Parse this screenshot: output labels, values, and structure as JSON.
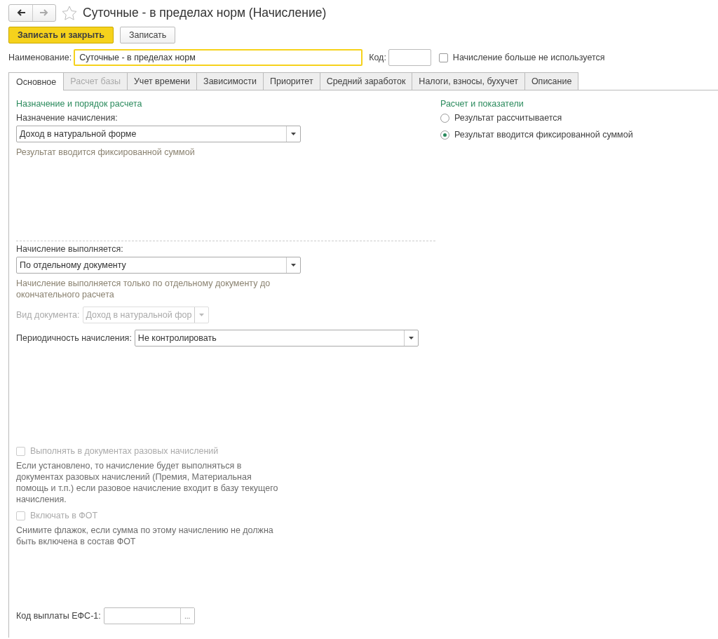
{
  "nav": [
    {
      "kind": "back",
      "disabled": false
    },
    {
      "kind": "forward",
      "disabled": true
    }
  ],
  "favorite": false,
  "title": "Суточные - в пределах норм (Начисление)",
  "buttons": [
    {
      "label": "Записать и закрыть",
      "kind": "primary"
    },
    {
      "label": "Записать",
      "kind": "secondary"
    }
  ],
  "name_field": {
    "label": "Наименование:",
    "value": "Суточные - в пределах норм",
    "focused": true
  },
  "code_field": {
    "label": "Код:"
  },
  "not_used": {
    "label": "Начисление больше не используется",
    "checked": false
  },
  "tabs": [
    {
      "label": "Основное",
      "selected": true,
      "disabled": false
    },
    {
      "label": "Расчет базы",
      "selected": false,
      "disabled": true
    },
    {
      "label": "Учет времени",
      "selected": false,
      "disabled": false
    },
    {
      "label": "Зависимости",
      "selected": false,
      "disabled": false
    },
    {
      "label": "Приоритет",
      "selected": false,
      "disabled": false
    },
    {
      "label": "Средний заработок",
      "selected": false,
      "disabled": false
    },
    {
      "label": "Налоги, взносы, бухучет",
      "selected": false,
      "disabled": false
    },
    {
      "label": "Описание",
      "selected": false,
      "disabled": false
    }
  ],
  "left": {
    "section_title": "Назначение и порядок расчета",
    "purpose": {
      "label": "Назначение начисления:",
      "value": "Доход в натуральной форме"
    },
    "purpose_note": "Результат вводится фиксированной суммой",
    "execution": {
      "label": "Начисление выполняется:",
      "value": "По отдельному документу"
    },
    "execution_note": "Начисление выполняется только по отдельному документу до окончательного расчета",
    "doc_type": {
      "label": "Вид документа:",
      "value": "Доход в натуральной фор",
      "disabled": true
    },
    "periodicity": {
      "label": "Периодичность начисления:",
      "value": "Не контролировать"
    },
    "one_time": {
      "label": "Выполнять в документах разовых начислений",
      "checked": false,
      "disabled": true
    },
    "one_time_note": "Если установлено, то начисление будет выполняться в документах разовых начислений (Премия, Материальная помощь и т.п.) если разовое начисление входит в базу текущего начисления.",
    "fot": {
      "label": "Включать в ФОТ",
      "checked": false,
      "disabled": true
    },
    "fot_note": "Снимите флажок, если сумма по этому начислению не должна быть включена в состав ФОТ",
    "efs": {
      "label": "Код выплаты ЕФС-1:",
      "button": "..."
    }
  },
  "right": {
    "section_title": "Расчет и показатели",
    "options": [
      {
        "label": "Результат рассчитывается",
        "selected": false
      },
      {
        "label": "Результат вводится фиксированной суммой",
        "selected": true
      }
    ]
  }
}
